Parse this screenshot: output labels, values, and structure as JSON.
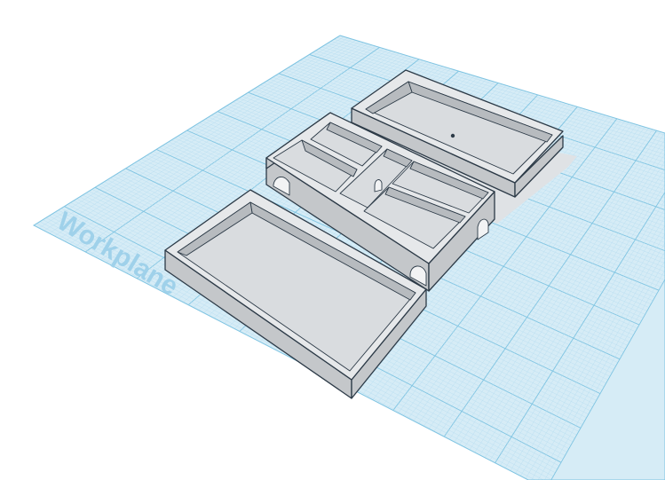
{
  "workplane": {
    "label": "Workplane",
    "fill_color": "#d6ecf6",
    "grid_major_color": "#7fc4e2",
    "grid_minor_color": "#b9def0",
    "label_color": "#9fd1ea"
  },
  "objects": [
    {
      "name": "tray-lid",
      "type": "box"
    },
    {
      "name": "compartment-organizer",
      "type": "box",
      "compartments": 5,
      "finger_holes": 4
    },
    {
      "name": "base-tray",
      "type": "box",
      "holes": 1
    }
  ],
  "colors": {
    "part_top": "#e6e8ea",
    "part_inner_floor": "#d9dcdf",
    "part_inner_wall": "#b7bbbf",
    "part_side": "#c4c7ca",
    "part_outline": "#2c3a47",
    "shadow": "#dfe2e5"
  }
}
